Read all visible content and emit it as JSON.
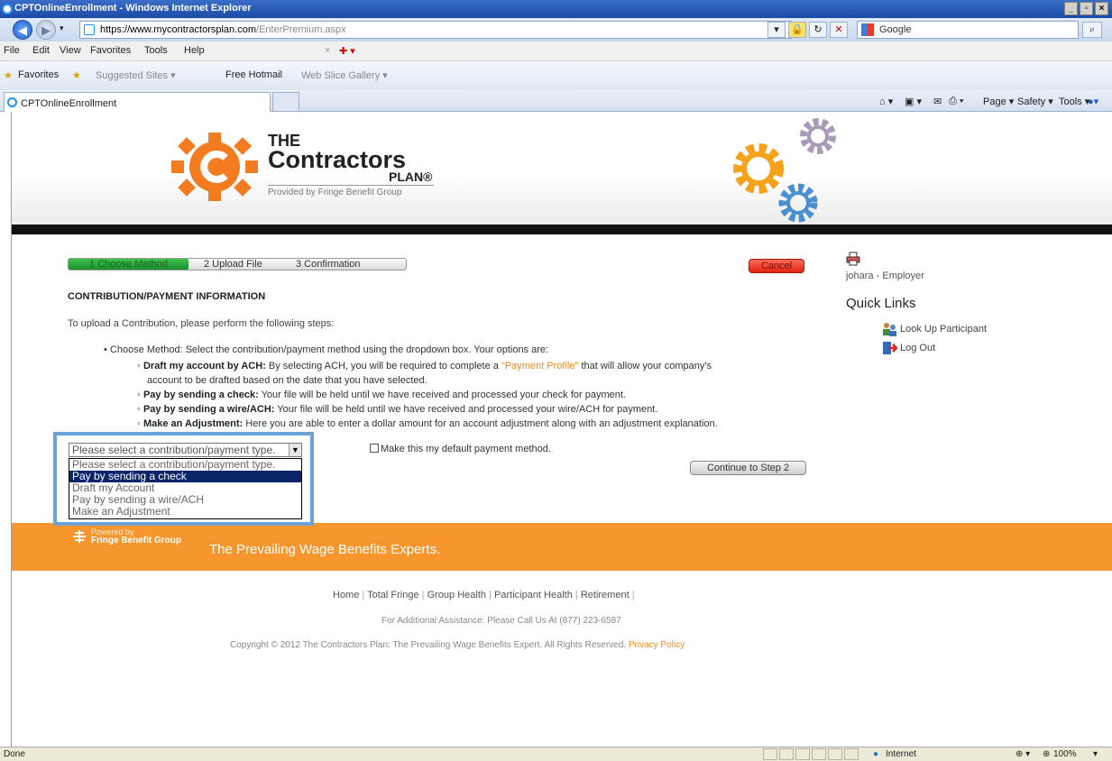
{
  "window": {
    "title": "CPTOnlineEnrollment - Windows Internet Explorer",
    "url_domain": "https://www.mycontractorsplan.com",
    "url_path": "/EnterPremium.aspx",
    "search_placeholder": "Google"
  },
  "menu": [
    "File",
    "Edit",
    "View",
    "Favorites",
    "Tools",
    "Help"
  ],
  "favorites_bar": {
    "label": "Favorites",
    "items": [
      "Suggested Sites ▾",
      "Free Hotmail",
      "Web Slice Gallery ▾"
    ]
  },
  "tab": {
    "label": "CPTOnlineEnrollment"
  },
  "command_bar": [
    "Page ▾",
    "Safety ▾",
    "Tools ▾"
  ],
  "brand": {
    "the": "THE",
    "name": "Contractors",
    "plan": "PLAN®",
    "provided": "Provided by Fringe Benefit Group"
  },
  "steps": [
    "1 Choose Method",
    "2 Upload File",
    "3 Confirmation"
  ],
  "cancel_label": "Cancel",
  "section_title": "CONTRIBUTION/PAYMENT INFORMATION",
  "intro": "To upload a Contribution, please perform the following steps:",
  "bullet": "Choose Method: Select the contribution/payment method using the dropdown box. Your options are:",
  "options_info": {
    "ach_bold": "Draft my account by ACH:",
    "ach_text1": " By selecting ACH, you will be required to complete a ",
    "ach_link": "\"Payment Profile\"",
    "ach_text2": " that will allow your company's",
    "ach_text3": "account to be drafted based on the date that you have selected.",
    "check_bold": "Pay by sending a check:",
    "check_text": " Your file will be held until we have received and processed your check for payment.",
    "wire_bold": "Pay by sending a wire/ACH:",
    "wire_text": " Your file will be held until we have received and processed your wire/ACH for payment.",
    "adj_bold": "Make an Adjustment:",
    "adj_text": " Here you are able to enter a dollar amount for an account adjustment along with an adjustment explanation."
  },
  "dropdown": {
    "selected": "Please select a contribution/payment type.",
    "options": [
      "Please select a contribution/payment type.",
      "Pay by sending a check",
      "Draft my Account",
      "Pay by sending a wire/ACH",
      "Make an Adjustment"
    ],
    "highlighted_index": 1
  },
  "default_checkbox_label": "Make this my default payment method.",
  "continue_label": "Continue to Step 2",
  "sidebar": {
    "user": "johara - Employer",
    "quick_links_title": "Quick Links",
    "links": [
      "Look Up Participant",
      "Log Out"
    ]
  },
  "footer": {
    "powered_by": "Powered by",
    "pbg_name": "Fringe Benefit Group",
    "tagline": "The Prevailing Wage Benefits Experts.",
    "links": [
      "Home",
      "Total Fringe",
      "Group Health",
      "Participant Health",
      "Retirement"
    ],
    "assistance": "For Additional Assistance: Please Call Us At (877) 223-6587",
    "copyright": "Copyright © 2012 The Contractors Plan: The Prevailing Wage Benefits Expert. All Rights Reserved.",
    "privacy": "Privacy Policy"
  },
  "statusbar": {
    "left": "Done",
    "zone": "Internet",
    "zoom": "100%"
  },
  "colors": {
    "accent_orange": "#f6962c",
    "step_green": "#2aa83b",
    "cancel_red": "#e8321e",
    "select_highlight": "#0a246a",
    "focus_frame": "#6ca3d6"
  }
}
